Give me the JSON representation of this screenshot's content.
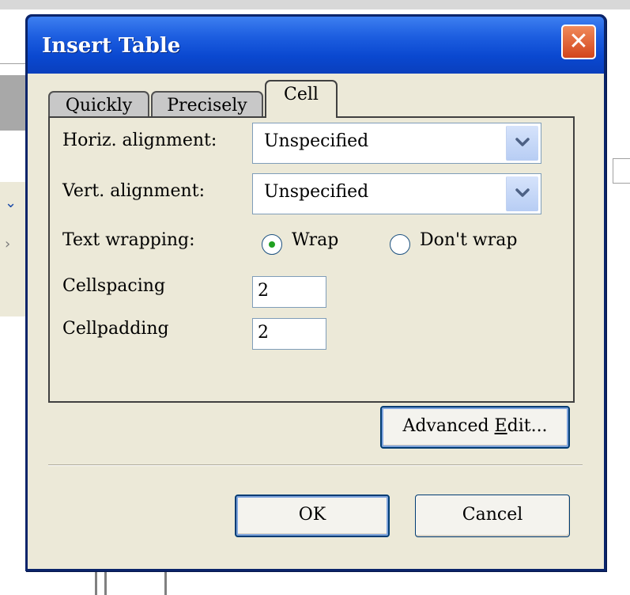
{
  "dialog": {
    "title": "Insert Table",
    "close_glyph": "✕",
    "tabs": [
      {
        "label": "Quickly",
        "active": false
      },
      {
        "label": "Precisely",
        "active": false
      },
      {
        "label": "Cell",
        "active": true
      }
    ],
    "cell": {
      "horiz_label": "Horiz. alignment:",
      "horiz_value": "Unspecified",
      "vert_label": "Vert. alignment:",
      "vert_value": "Unspecified",
      "wrap_label": "Text wrapping:",
      "wrap_option": "Wrap",
      "nowrap_option": "Don't wrap",
      "wrap_selected": "Wrap",
      "cellspacing_label": "Cellspacing",
      "cellspacing_value": "2",
      "cellpadding_label": "Cellpadding",
      "cellpadding_value": "2"
    },
    "advanced_edit_prefix": "Advanced ",
    "advanced_edit_mnemonic": "E",
    "advanced_edit_suffix": "dit...",
    "ok_label": "OK",
    "cancel_label": "Cancel"
  },
  "icons": {
    "close": "close-icon",
    "dropdown": "chevron-down-icon",
    "radio_selected": "radio-selected-icon"
  },
  "colors": {
    "title_bar": "#0a48d0",
    "close_button": "#d2451c",
    "dialog_bg": "#ece9d8",
    "radio_dot": "#21a121"
  }
}
